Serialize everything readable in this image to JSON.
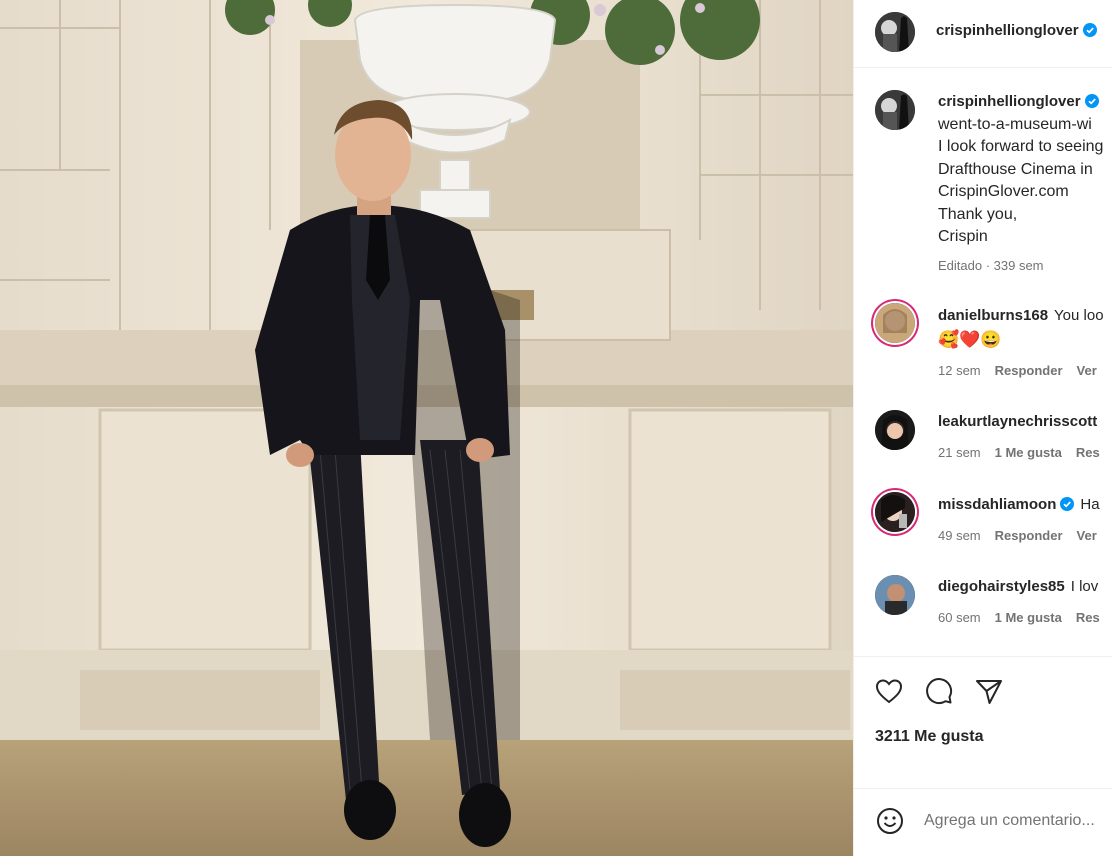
{
  "post": {
    "author": "crispinhellionglover",
    "verified": true,
    "caption_lines": [
      "went-to-a-museum-wi",
      "I look forward to seeing",
      "Drafthouse Cinema in",
      "CrispinGlover.com",
      "Thank you,",
      "Crispin"
    ],
    "edited_label": "Editado · 339 sem"
  },
  "comments": [
    {
      "user": "danielburns168",
      "verified": false,
      "text": "You loo",
      "emoji": "🥰❤️😀",
      "time": "12 sem",
      "likes": "",
      "reply": "Responder",
      "more": "Ver"
    },
    {
      "user": "leakurtlaynechrisscott",
      "verified": false,
      "text": "",
      "time": "21 sem",
      "likes": "1 Me gusta",
      "reply": "Res",
      "more": ""
    },
    {
      "user": "missdahliamoon",
      "verified": true,
      "text": "Ha",
      "time": "49 sem",
      "likes": "",
      "reply": "Responder",
      "more": "Ver"
    },
    {
      "user": "diegohairstyles85",
      "verified": false,
      "text": "I lov",
      "time": "60 sem",
      "likes": "1 Me gusta",
      "reply": "Res",
      "more": ""
    }
  ],
  "actions": {
    "like_icon": "heart-icon",
    "comment_icon": "comment-icon",
    "share_icon": "send-icon"
  },
  "likes_label": "3211 Me gusta",
  "comment_box": {
    "placeholder": "Agrega un comentario...",
    "emoji_icon": "smile-icon"
  },
  "colors": {
    "verified": "#0095f6",
    "story_ring": "#d62976",
    "heart": "#ed4956",
    "muted": "#737373"
  }
}
